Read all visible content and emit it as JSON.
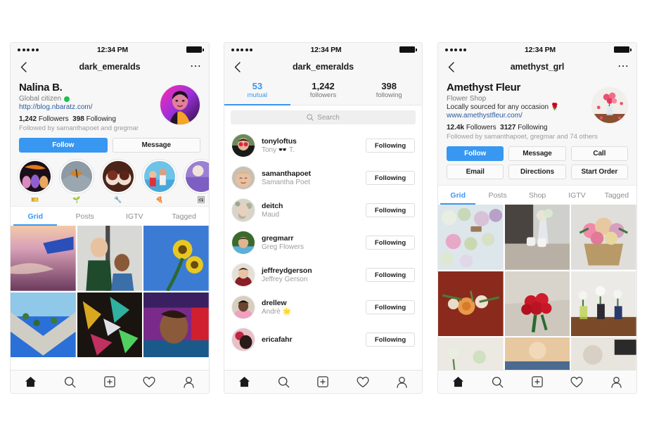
{
  "status_bar": {
    "time": "12:34 PM",
    "signal_dots": 5
  },
  "colors": {
    "accent": "#3897f0",
    "link": "#2b5b9e",
    "muted": "#8e8e8e",
    "online": "#1bc34a"
  },
  "bottom_nav": [
    {
      "name": "home-icon",
      "label": "Home"
    },
    {
      "name": "search-icon",
      "label": "Search"
    },
    {
      "name": "add-post-icon",
      "label": "New Post"
    },
    {
      "name": "activity-heart-icon",
      "label": "Activity"
    },
    {
      "name": "profile-icon",
      "label": "Profile"
    }
  ],
  "phone1": {
    "nav": {
      "title": "dark_emeralds",
      "back_icon": "chevron-left-icon",
      "more_icon": "more-options-icon"
    },
    "profile": {
      "display_name": "Nalina B.",
      "category": "Global citizen",
      "website": "http://blog.nbaratz.com/",
      "followers_count": "1,242",
      "followers_label": "Followers",
      "following_count": "398",
      "following_label": "Following",
      "followed_by": "Followed by samanthapoet and gregmar"
    },
    "actions": [
      {
        "label": "Follow",
        "primary": true
      },
      {
        "label": "Message",
        "primary": false
      }
    ],
    "highlights": [
      {
        "label": "🎫"
      },
      {
        "label": "🌱"
      },
      {
        "label": "🔧"
      },
      {
        "label": "🍕"
      },
      {
        "label": "🖼"
      }
    ],
    "tabs": [
      {
        "label": "Grid",
        "active": true
      },
      {
        "label": "Posts",
        "active": false
      },
      {
        "label": "IGTV",
        "active": false
      },
      {
        "label": "Tagged",
        "active": false
      }
    ]
  },
  "phone2": {
    "nav": {
      "title": "dark_emeralds",
      "back_icon": "chevron-left-icon"
    },
    "count_tabs": [
      {
        "number": "53",
        "label": "mutual",
        "active": true
      },
      {
        "number": "1,242",
        "label": "followers",
        "active": false
      },
      {
        "number": "398",
        "label": "following",
        "active": false
      }
    ],
    "search": {
      "placeholder": "Search",
      "value": "",
      "icon": "search-icon"
    },
    "users": [
      {
        "username": "tonyloftus",
        "fullname": "Tony 🕶️ T.",
        "button": "Following"
      },
      {
        "username": "samanthapoet",
        "fullname": "Samantha Poet",
        "button": "Following"
      },
      {
        "username": "deitch",
        "fullname": "Maud",
        "button": "Following"
      },
      {
        "username": "gregmarr",
        "fullname": "Greg Flowers",
        "button": "Following"
      },
      {
        "username": "jeffreydgerson",
        "fullname": "Jeffrey Gerson",
        "button": "Following"
      },
      {
        "username": "drellew",
        "fullname": "Andrè 🌟",
        "button": "Following"
      },
      {
        "username": "ericafahr",
        "fullname": "",
        "button": "Following"
      }
    ]
  },
  "phone3": {
    "nav": {
      "title": "amethyst_grl",
      "back_icon": "chevron-left-icon",
      "more_icon": "more-options-icon"
    },
    "profile": {
      "display_name": "Amethyst Fleur",
      "category": "Flower Shop",
      "bio": "Locally sourced for any occasion 🌹",
      "website": "www.amethystfleur.com/",
      "followers_count": "12.4k",
      "followers_label": "Followers",
      "following_count": "3127",
      "following_label": "Following",
      "followed_by": "Followed by samanthapoet, gregmar and 74 others"
    },
    "actions_row1": [
      {
        "label": "Follow",
        "primary": true
      },
      {
        "label": "Message",
        "primary": false
      },
      {
        "label": "Call",
        "primary": false
      }
    ],
    "actions_row2": [
      {
        "label": "Email",
        "primary": false
      },
      {
        "label": "Directions",
        "primary": false
      },
      {
        "label": "Start Order",
        "primary": false
      }
    ],
    "tabs": [
      {
        "label": "Grid",
        "active": true
      },
      {
        "label": "Posts",
        "active": false
      },
      {
        "label": "Shop",
        "active": false
      },
      {
        "label": "IGTV",
        "active": false
      },
      {
        "label": "Tagged",
        "active": false
      }
    ]
  }
}
